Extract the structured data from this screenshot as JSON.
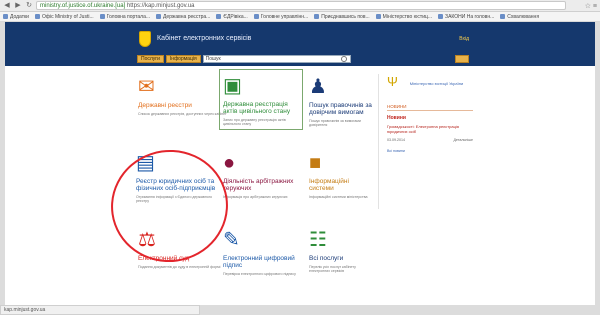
{
  "browser": {
    "url_host": "ministry.of.justice.of.ukraine.[ua]",
    "url_path": " https://kap.minjust.gov.ua",
    "bookmarks": [
      {
        "label": "Додатки"
      },
      {
        "label": "Офіс Ministry of Justi..."
      },
      {
        "label": "Головна портала..."
      },
      {
        "label": "Державна реєстра..."
      },
      {
        "label": "ЄДРівіка..."
      },
      {
        "label": "Головне управлінн..."
      },
      {
        "label": "Приєднавшись пов..."
      },
      {
        "label": "Міністерство юстиц..."
      },
      {
        "label": "ЗАКОНИ На головн..."
      },
      {
        "label": "Схвалювання"
      }
    ],
    "status_text": "kap.minjust.gov.ua"
  },
  "header": {
    "title": "Кабінет електронних сервісів",
    "right_link": "Вхід",
    "search_btn1": "Послуги",
    "search_btn2": "Інформація",
    "search_placeholder": "Пошук"
  },
  "tiles": [
    {
      "title": "Державні реєстри",
      "desc": "Список державних реєстрів, доступних через кабінет",
      "icon": "document-stamp-icon",
      "color": "#e26f1c"
    },
    {
      "title": "Державна реєстрація актів цивільного стану",
      "desc": "Запис про державну реєстрацію актів цивільного стану",
      "icon": "green-book-icon",
      "color": "#2f8d3a"
    },
    {
      "title": "Пошук правочинів за довірчим вимогам",
      "desc": "Пошук правочинів за вимогами довірителя",
      "icon": "person-lectern-icon",
      "color": "#1b3b77"
    },
    {
      "title": "Реєстр юридичних осіб та фізичних осіб-підприємців",
      "desc": "Отримання інформації з Єдиного державного реєстру",
      "icon": "document-list-icon",
      "color": "#1d5aa8"
    },
    {
      "title": "Діяльність арбітражних керуючих",
      "desc": "Інформація про арбітражних керуючих",
      "icon": "person-silhouette-icon",
      "color": "#8a1640"
    },
    {
      "title": "Інформаційні системи",
      "desc": "Інформаційні системи міністерства",
      "icon": "book-icon",
      "color": "#c47c14"
    },
    {
      "title": "Електронний суд",
      "desc": "Подання документів до суду в електронній формі",
      "icon": "scales-icon",
      "color": "#d8231f"
    },
    {
      "title": "Електронний цифровий підпис",
      "desc": "Перевірка електронного цифрового підпису",
      "icon": "pen-signature-icon",
      "color": "#1d5aa8"
    },
    {
      "title": "Всі послуги",
      "desc": "Перелік усіх послуг кабінету електронних сервісів",
      "icon": "basket-icon",
      "color": "#2f8d3a"
    }
  ],
  "sidebar": {
    "org_title": "Міністерство юстиції України",
    "section": "НОВИНИ",
    "news_heading": "Новини",
    "news_item": "Громадськості: Електронна реєстрація юридичних осіб",
    "news_date": "03.09.2014",
    "news_more": "Детальніше",
    "all_news": "Всі новини"
  }
}
